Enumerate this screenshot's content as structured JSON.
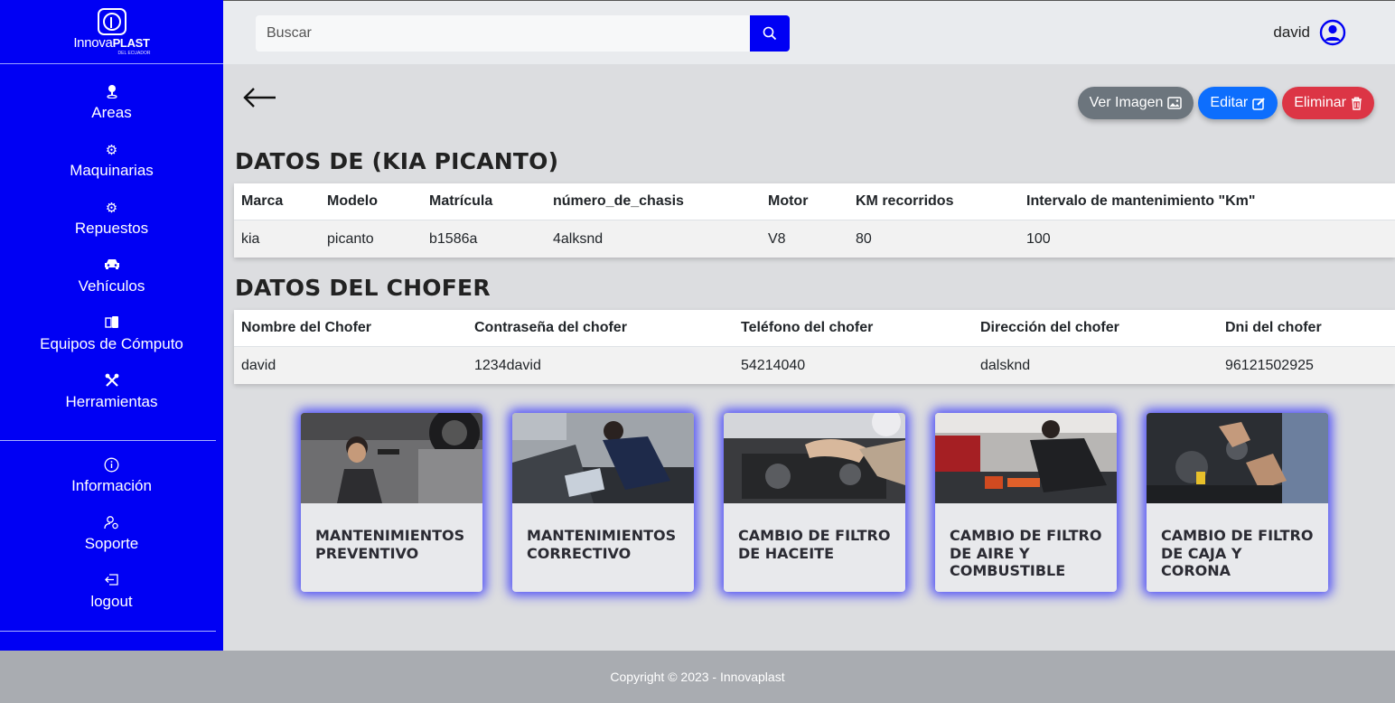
{
  "brand": {
    "name_light": "Innova",
    "name_bold": "PLAST",
    "sub": "DEL ECUADOR"
  },
  "sidebar": {
    "items": [
      {
        "label": "Areas",
        "icon": "pin-icon"
      },
      {
        "label": "Maquinarias",
        "icon": "gear-icon"
      },
      {
        "label": "Repuestos",
        "icon": "gear-icon"
      },
      {
        "label": "Vehículos",
        "icon": "car-icon"
      },
      {
        "label": "Equipos de Cómputo",
        "icon": "devices-icon"
      },
      {
        "label": "Herramientas",
        "icon": "tools-icon"
      }
    ],
    "secondary": [
      {
        "label": "Información",
        "icon": "info-icon"
      },
      {
        "label": "Soporte",
        "icon": "support-icon"
      },
      {
        "label": "logout",
        "icon": "logout-icon"
      }
    ]
  },
  "search": {
    "placeholder": "Buscar"
  },
  "user": {
    "name": "david"
  },
  "actions": {
    "view_image": "Ver Imagen",
    "edit": "Editar",
    "delete": "Eliminar"
  },
  "vehicle": {
    "title": "DATOS DE (KIA PICANTO)",
    "headers": [
      "Marca",
      "Modelo",
      "Matrícula",
      "número_de_chasis",
      "Motor",
      "KM recorridos",
      "Intervalo de mantenimiento \"Km\""
    ],
    "row": [
      "kia",
      "picanto",
      "b1586a",
      "4alksnd",
      "V8",
      "80",
      "100"
    ]
  },
  "driver": {
    "title": "DATOS DEL CHOFER",
    "headers": [
      "Nombre del Chofer",
      "Contraseña del chofer",
      "Teléfono del chofer",
      "Dirección del chofer",
      "Dni del chofer"
    ],
    "row": [
      "david",
      "1234david",
      "54214040",
      "dalsknd",
      "96121502925"
    ]
  },
  "cards": [
    {
      "title": "MANTENIMIENTOS PREVENTIVO"
    },
    {
      "title": "MANTENIMIENTOS CORRECTIVO"
    },
    {
      "title": "CAMBIO DE FILTRO DE HACEITE"
    },
    {
      "title": "CAMBIO DE FILTRO DE AIRE Y COMBUSTIBLE"
    },
    {
      "title": "CAMBIO DE FILTRO DE CAJA Y CORONA"
    }
  ],
  "footer": {
    "text": "Copyright © 2023 - Innovaplast"
  }
}
